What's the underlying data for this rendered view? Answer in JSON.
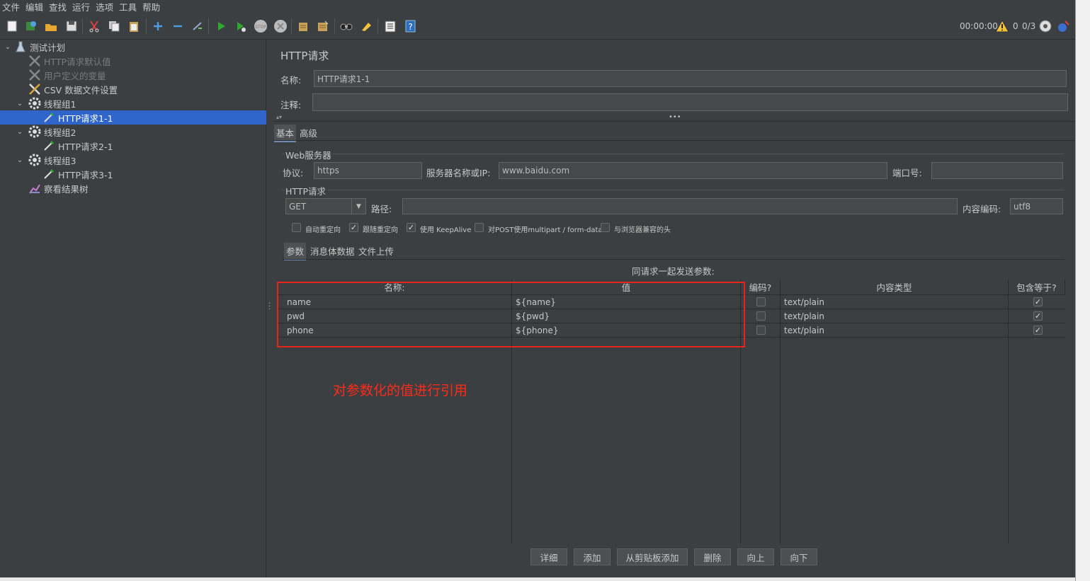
{
  "menu": [
    "文件",
    "编辑",
    "查找",
    "运行",
    "选项",
    "工具",
    "帮助"
  ],
  "toolbar": {
    "timer": "00:00:00",
    "warnings": "0",
    "threads": "0/3"
  },
  "tree": {
    "items": [
      {
        "label": "测试计划",
        "icon": "flask-icon"
      },
      {
        "label": "HTTP请求默认值",
        "icon": "wrench-icon",
        "disabled": true
      },
      {
        "label": "用户定义的变量",
        "icon": "wrench-icon",
        "disabled": true
      },
      {
        "label": "CSV 数据文件设置",
        "icon": "wrench-icon"
      },
      {
        "label": "线程组1",
        "icon": "gear-icon"
      },
      {
        "label": "HTTP请求1-1",
        "icon": "pipette-icon",
        "selected": true
      },
      {
        "label": "线程组2",
        "icon": "gear-icon"
      },
      {
        "label": "HTTP请求2-1",
        "icon": "pipette-icon"
      },
      {
        "label": "线程组3",
        "icon": "gear-icon"
      },
      {
        "label": "HTTP请求3-1",
        "icon": "pipette-icon"
      },
      {
        "label": "察看结果树",
        "icon": "chart-icon"
      }
    ]
  },
  "panel": {
    "title": "HTTP请求",
    "name_label": "名称:",
    "name_value": "HTTP请求1-1",
    "comment_label": "注释:",
    "comment_value": "",
    "tabs": [
      "基本",
      "高级"
    ],
    "web_server": {
      "legend": "Web服务器",
      "protocol_label": "协议:",
      "protocol_value": "https",
      "server_label": "服务器名称或IP:",
      "server_value": "www.baidu.com",
      "port_label": "端口号:",
      "port_value": ""
    },
    "http_request": {
      "legend": "HTTP请求",
      "method": "GET",
      "path_label": "路径:",
      "path_value": "",
      "encoding_label": "内容编码:",
      "encoding_value": "utf8"
    },
    "options": [
      {
        "label": "自动重定向",
        "checked": false
      },
      {
        "label": "跟随重定向",
        "checked": true
      },
      {
        "label": "使用 KeepAlive",
        "checked": true
      },
      {
        "label": "对POST使用multipart / form-data",
        "checked": false
      },
      {
        "label": "与浏览器兼容的头",
        "checked": false
      }
    ],
    "subtabs": [
      "参数",
      "消息体数据",
      "文件上传"
    ],
    "params_caption": "同请求一起发送参数:",
    "table": {
      "headers": [
        "名称:",
        "值",
        "编码?",
        "内容类型",
        "包含等于?"
      ],
      "rows": [
        {
          "name": "name",
          "value": "${name}",
          "encode": false,
          "content_type": "text/plain",
          "include_equals": true
        },
        {
          "name": "pwd",
          "value": "${pwd}",
          "encode": false,
          "content_type": "text/plain",
          "include_equals": true
        },
        {
          "name": "phone",
          "value": "${phone}",
          "encode": false,
          "content_type": "text/plain",
          "include_equals": true
        }
      ]
    },
    "annotation": "对参数化的值进行引用",
    "buttons": [
      "详细",
      "添加",
      "从剪贴板添加",
      "删除",
      "向上",
      "向下"
    ]
  },
  "colors": {
    "background": "#3c3f41",
    "selection": "#2f65ca",
    "annotation": "#ff2a1a"
  }
}
